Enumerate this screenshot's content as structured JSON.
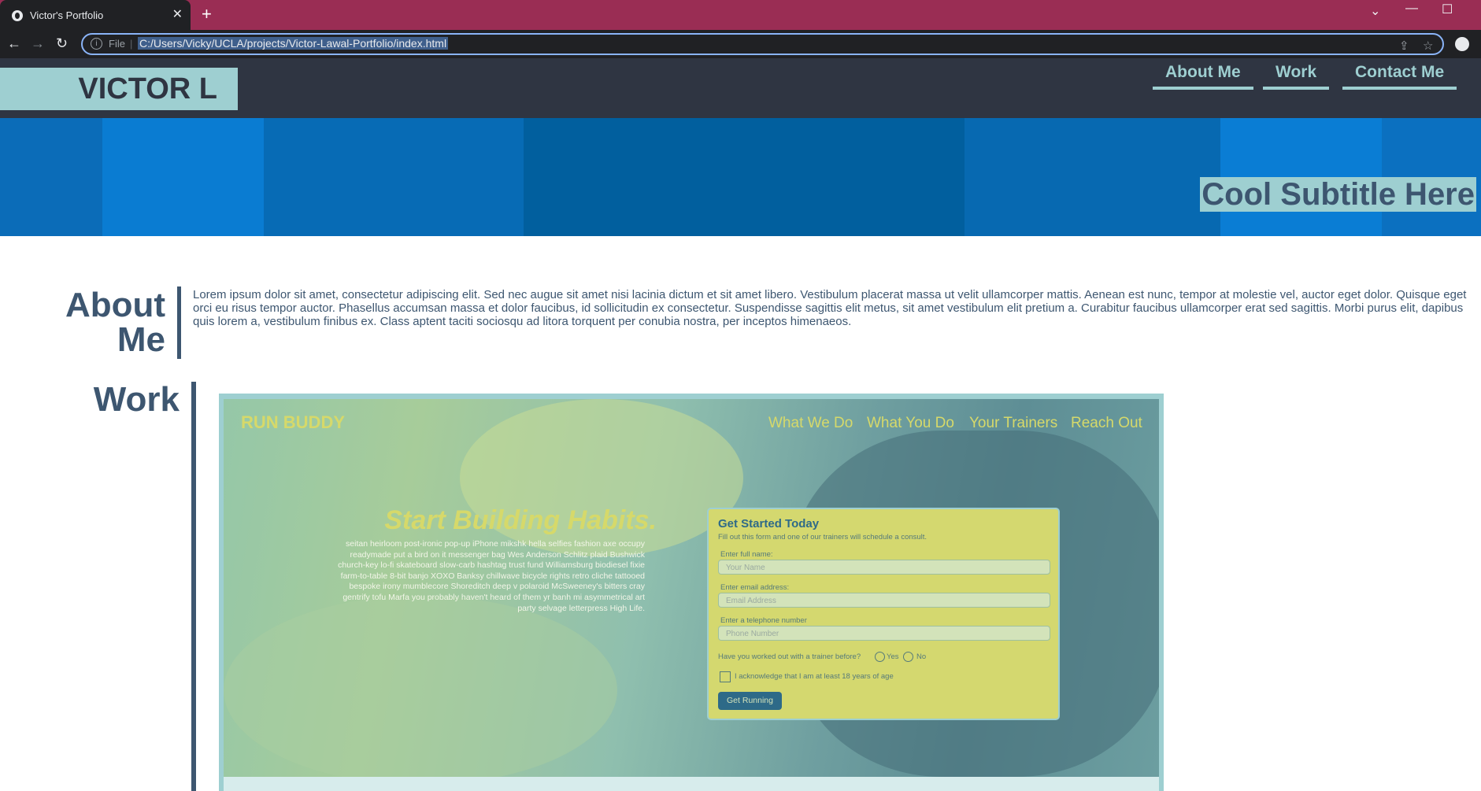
{
  "browser": {
    "tab_title": "Victor's Portfolio",
    "tab_close": "✕",
    "new_tab": "+",
    "file_label": "File",
    "url": "C:/Users/Vicky/UCLA/projects/Victor-Lawal-Portfolio/index.html",
    "window_controls": [
      "⌄",
      "—",
      "☐"
    ]
  },
  "site": {
    "logo": "VICTOR L",
    "nav": [
      "About Me",
      "Work",
      "Contact Me"
    ],
    "hero_subtitle": "Cool Subtitle Here",
    "about": {
      "title_line1": "About",
      "title_line2": "Me",
      "body": "Lorem ipsum dolor sit amet, consectetur adipiscing elit. Sed nec augue sit amet nisi lacinia dictum et sit amet libero. Vestibulum placerat massa ut velit ullamcorper mattis. Aenean est nunc, tempor at molestie vel, auctor eget dolor. Quisque eget orci eu risus tempor auctor. Phasellus accumsan massa et dolor faucibus, id sollicitudin ex consectetur. Suspendisse sagittis elit metus, sit amet vestibulum elit pretium a. Curabitur faucibus ullamcorper erat sed sagittis. Morbi purus elit, dapibus quis lorem a, vestibulum finibus ex. Class aptent taciti sociosqu ad litora torquent per conubia nostra, per inceptos himenaeos."
    },
    "work": {
      "title": "Work",
      "project": {
        "logo": "RUN BUDDY",
        "nav": [
          "What We Do",
          "What You Do",
          "Your Trainers",
          "Reach Out"
        ],
        "headline": "Start Building Habits.",
        "copy": "seitan heirloom post-ironic pop-up iPhone mikshk hella selfies fashion axe occupy readymade put a bird on it messenger bag Wes Anderson Schlitz plaid Bushwick church-key lo-fi skateboard slow-carb hashtag trust fund Williamsburg biodiesel fixie farm-to-table 8-bit banjo XOXO Banksy chillwave bicycle rights retro cliche tattooed bespoke irony mumblecore Shoreditch deep v polaroid McSweeney's bitters cray gentrify tofu Marfa you probably haven't heard of them yr banh mi asymmetrical art party selvage letterpress High Life.",
        "form": {
          "heading": "Get Started Today",
          "intro": "Fill out this form and one of our trainers will schedule a consult.",
          "name_label": "Enter full name:",
          "name_placeholder": "Your Name",
          "email_label": "Enter email address:",
          "email_placeholder": "Email Address",
          "phone_label": "Enter a telephone number",
          "phone_placeholder": "Phone Number",
          "question": "Have you worked out with a trainer before?",
          "yes": "Yes",
          "no": "No",
          "ack": "I acknowledge that I am at least 18 years of age",
          "submit": "Get Running"
        }
      }
    }
  },
  "colors": {
    "header_bg": "#2f3542",
    "accent": "#9ecfd1",
    "heading": "#3d5670",
    "hero_blue": "#0a7ad0",
    "browser_frame": "#9a2d54"
  }
}
